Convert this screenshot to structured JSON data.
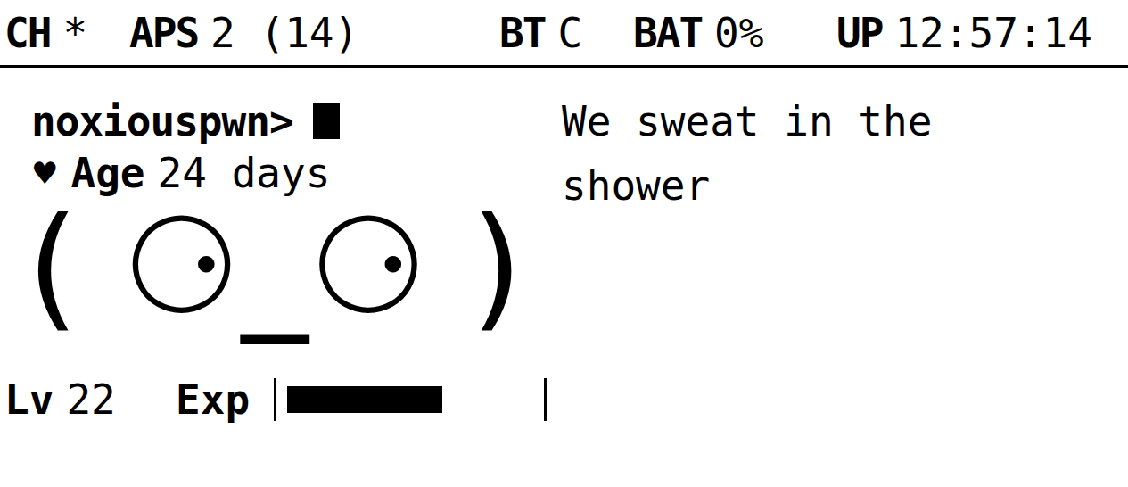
{
  "status_bar": [
    {
      "label": "CH",
      "value": "*"
    },
    {
      "label": "APS",
      "value": "2 (14)"
    },
    {
      "label": "BT",
      "value": "C"
    },
    {
      "label": "BAT",
      "value": "0%"
    },
    {
      "label": "UP",
      "value": "12:57:14"
    }
  ],
  "prompt": {
    "text": "noxiouspwn>",
    "cursor": true
  },
  "age": {
    "icon": "♥",
    "label": "Age",
    "value": "24 days"
  },
  "face": "( ⚆_⚆ )",
  "level": {
    "label": "Lv",
    "value": "22"
  },
  "exp": {
    "label": "Exp",
    "level": 0.63
  },
  "message": "We sweat in the shower"
}
